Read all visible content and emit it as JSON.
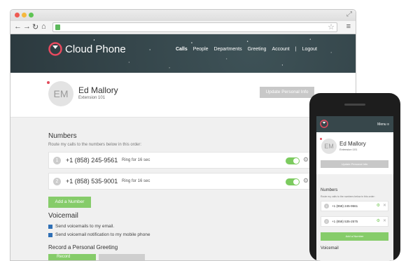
{
  "browser": {
    "expand_icon": "expand-icon"
  },
  "app": {
    "brand": "Cloud Phone",
    "nav": [
      "Calls",
      "People",
      "Departments",
      "Greeting",
      "Account",
      "|",
      "Logout"
    ],
    "profile": {
      "initials": "EM",
      "name": "Ed Mallory",
      "extension": "Extension 101",
      "update_label": "Update Personal Info"
    },
    "numbers": {
      "heading": "Numbers",
      "subtitle": "Route my calls to the numbers below in this order:",
      "items": [
        {
          "order": "1",
          "phone": "+1 (858) 245-9561",
          "ring": "Ring for 16 sec"
        },
        {
          "order": "2",
          "phone": "+1 (858) 535-9001",
          "ring": "Ring for 16 sec"
        }
      ],
      "add_label": "Add a Number"
    },
    "voicemail": {
      "heading": "Voicemail",
      "options": [
        "Send voicemails to my email.",
        "Send voicemail notification to my mobile phone"
      ]
    },
    "greeting": {
      "heading": "Record a Personal Greeting",
      "button_label": "Record"
    }
  },
  "mobile": {
    "menu_label": "Menu",
    "profile": {
      "initials": "EM",
      "name": "Ed Mallory",
      "extension": "Extension 101",
      "update_label": "Update Personal Info"
    },
    "numbers": {
      "heading": "Numbers",
      "subtitle": "Route my calls to the numbers below in this order:",
      "items": [
        {
          "order": "1",
          "phone": "+1 (858) 245-9561"
        },
        {
          "order": "2",
          "phone": "+1 (858) 535-2575"
        }
      ],
      "add_label": "Add a Number"
    },
    "voicemail_heading": "Voicemail"
  }
}
